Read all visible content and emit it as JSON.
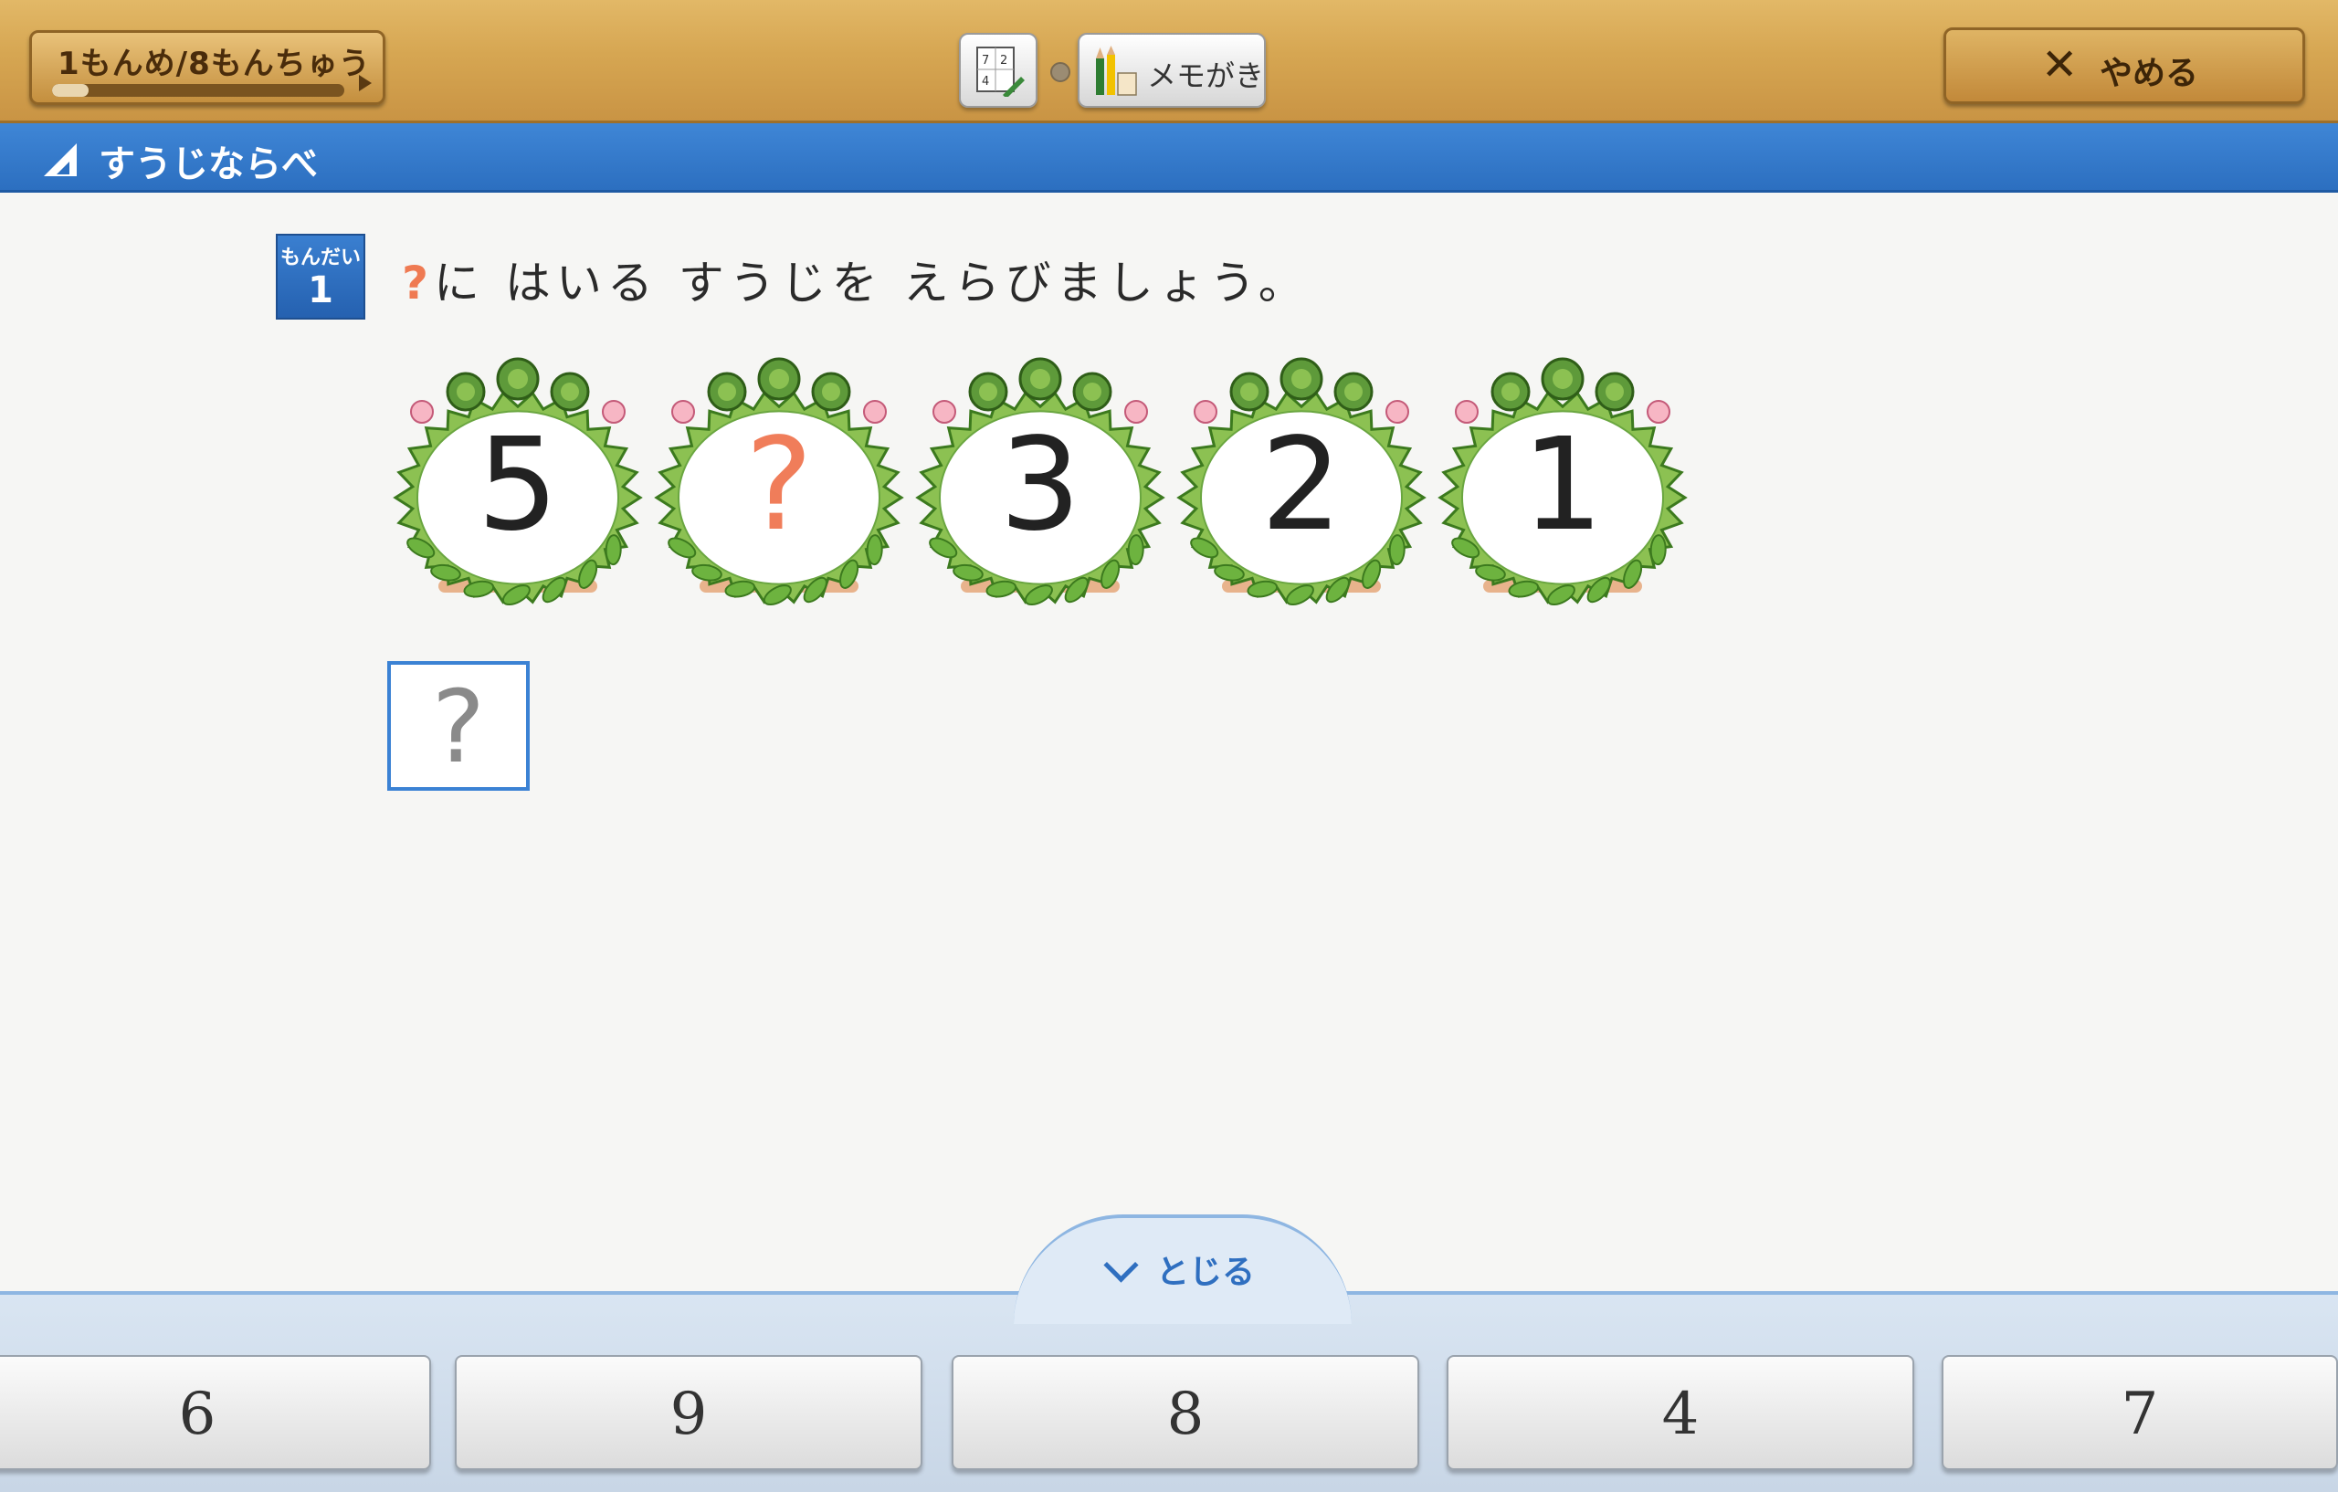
{
  "header": {
    "progress_label": "1もんめ/8もんちゅう",
    "progress_fraction": 0.125,
    "calculator_icon": "calculator-pen-icon",
    "memo_label": "メモがき",
    "memo_icon": "pencils-icon",
    "quit_symbol": "✕",
    "quit_label": "やめる"
  },
  "title_bar": {
    "title": "すうじならべ"
  },
  "question": {
    "badge_label": "もんだい",
    "badge_number": "1",
    "prompt_mark": "?",
    "prompt_text": "に はいる すうじを えらびましょう。"
  },
  "sequence": [
    "5",
    "?",
    "3",
    "2",
    "1"
  ],
  "answer_box": {
    "placeholder": "?"
  },
  "keypad": {
    "close_label": "とじる",
    "keys": [
      "6",
      "9",
      "8",
      "4",
      "7"
    ]
  },
  "colors": {
    "accent_blue": "#2c6fc0",
    "unknown_orange": "#f07d5a",
    "wood": "#d6a652"
  }
}
